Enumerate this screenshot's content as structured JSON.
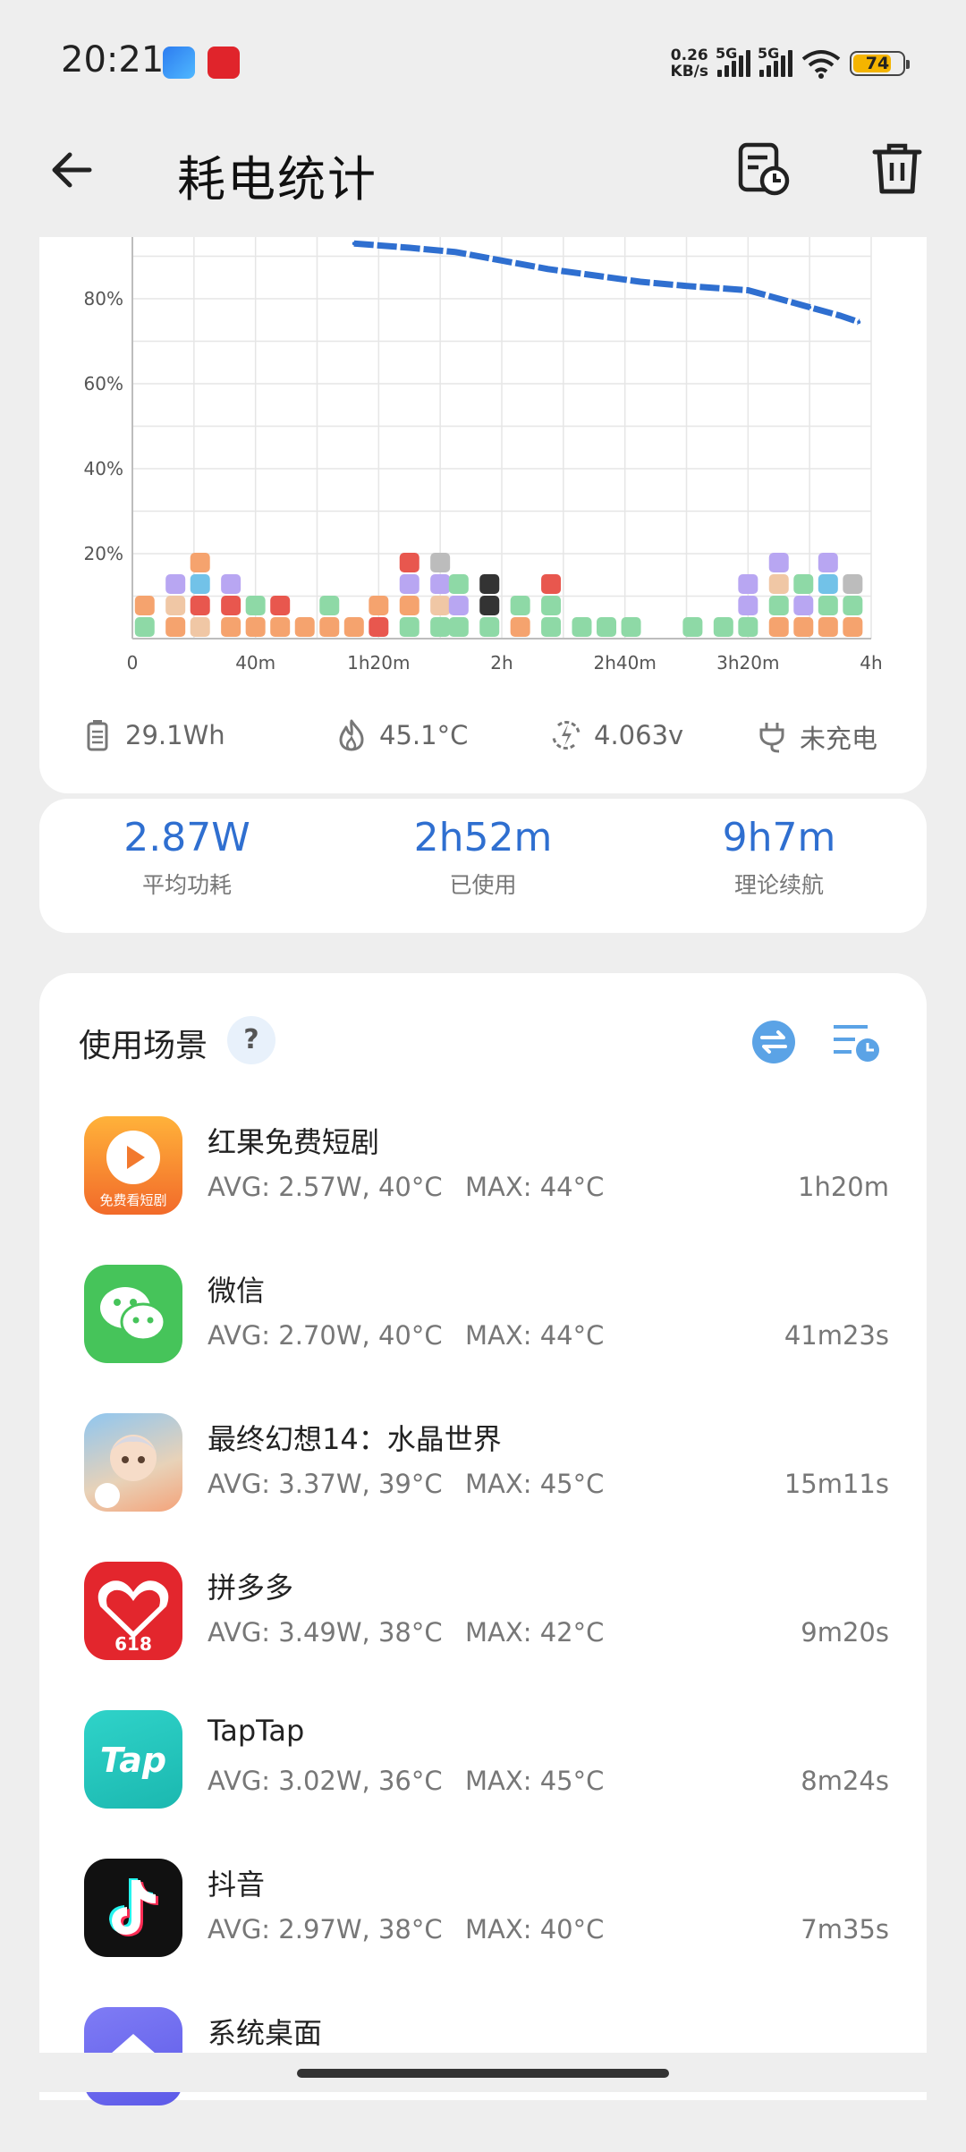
{
  "status_bar": {
    "time": "20:21",
    "net_speed_value": "0.26",
    "net_speed_unit": "KB/s",
    "sim1": "5G",
    "sim2": "5G",
    "battery": "74",
    "icons": [
      "gallery-app-icon",
      "pinduoduo-app-icon",
      "signal-icon",
      "wifi-icon",
      "battery-icon"
    ]
  },
  "header": {
    "back_icon": "arrow-left-icon",
    "title": "耗电统计",
    "history_icon": "history-icon",
    "delete_icon": "trash-icon"
  },
  "chart_data": {
    "type": "line",
    "x_ticks": [
      "0",
      "40m",
      "1h20m",
      "2h",
      "2h40m",
      "3h20m",
      "4h"
    ],
    "y_ticks": [
      "20%",
      "40%",
      "60%",
      "80%"
    ],
    "xlim_minutes": [
      0,
      240
    ],
    "ylim": [
      0,
      100
    ],
    "grid": true,
    "series": [
      {
        "x_minutes": [
          72,
          90,
          105,
          120,
          135,
          150,
          165,
          180,
          190,
          200,
          210,
          220,
          230,
          236
        ],
        "y": [
          93,
          92,
          91,
          89,
          87,
          85.5,
          84,
          83,
          82.5,
          82,
          80,
          78,
          76,
          74.5
        ]
      }
    ],
    "accent_color": "#2f6fd0",
    "note_markers": "app usage icons stacked along the bottom of the chart"
  },
  "metrics": {
    "capacity": "29.1Wh",
    "temperature": "45.1°C",
    "voltage": "4.063v",
    "charge_state": "未充电"
  },
  "stats": [
    {
      "value": "2.87W",
      "label": "平均功耗"
    },
    {
      "value": "2h52m",
      "label": "已使用"
    },
    {
      "value": "9h7m",
      "label": "理论续航"
    }
  ],
  "scenes": {
    "title": "使用场景",
    "help": "?",
    "apps": [
      {
        "name": "红果免费短剧",
        "avg": "AVG: 2.57W, 40°C",
        "max": "MAX:  44°C",
        "duration": "1h20m",
        "icon": "hongguo-app-icon",
        "icon_text": "免费看短剧"
      },
      {
        "name": "微信",
        "avg": "AVG: 2.70W, 40°C",
        "max": "MAX:  44°C",
        "duration": "41m23s",
        "icon": "wechat-app-icon"
      },
      {
        "name": "最终幻想14：水晶世界",
        "avg": "AVG: 3.37W, 39°C",
        "max": "MAX:  45°C",
        "duration": "15m11s",
        "icon": "ff14-app-icon"
      },
      {
        "name": "拼多多",
        "avg": "AVG: 3.49W, 38°C",
        "max": "MAX:  42°C",
        "duration": "9m20s",
        "icon": "pinduoduo-app-icon",
        "icon_text": "618"
      },
      {
        "name": "TapTap",
        "avg": "AVG: 3.02W, 36°C",
        "max": "MAX:  45°C",
        "duration": "8m24s",
        "icon": "taptap-app-icon",
        "icon_text": "Tap"
      },
      {
        "name": "抖音",
        "avg": "AVG: 2.97W, 38°C",
        "max": "MAX:  40°C",
        "duration": "7m35s",
        "icon": "douyin-app-icon"
      },
      {
        "name": "系统桌面",
        "avg": "",
        "max": "",
        "duration": "",
        "icon": "launcher-app-icon"
      }
    ]
  }
}
